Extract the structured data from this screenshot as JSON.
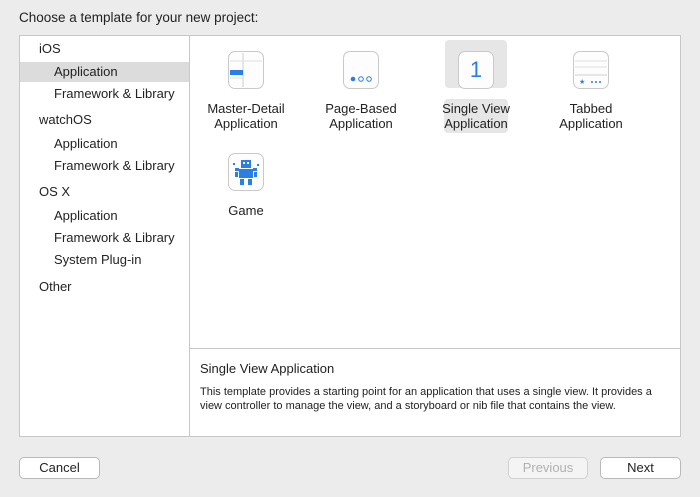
{
  "header": {
    "title": "Choose a template for your new project:"
  },
  "sidebar": {
    "groups": [
      {
        "label": "iOS",
        "items": [
          {
            "label": "Application",
            "selected": true
          },
          {
            "label": "Framework & Library"
          }
        ]
      },
      {
        "label": "watchOS",
        "items": [
          {
            "label": "Application"
          },
          {
            "label": "Framework & Library"
          }
        ]
      },
      {
        "label": "OS X",
        "items": [
          {
            "label": "Application"
          },
          {
            "label": "Framework & Library"
          },
          {
            "label": "System Plug-in"
          }
        ]
      },
      {
        "label": "Other",
        "items": []
      }
    ]
  },
  "templates": [
    {
      "line1": "Master-Detail",
      "line2": "Application",
      "icon": "master-detail-icon"
    },
    {
      "line1": "Page-Based",
      "line2": "Application",
      "icon": "page-based-icon"
    },
    {
      "line1": "Single View",
      "line2": "Application",
      "icon": "single-view-icon",
      "glyph": "1",
      "selected": true
    },
    {
      "line1": "Tabbed",
      "line2": "Application",
      "icon": "tabbed-icon",
      "glyph": "★ •••"
    },
    {
      "line1": "Game",
      "line2": "",
      "icon": "game-icon"
    }
  ],
  "description": {
    "title": "Single View Application",
    "text": "This template provides a starting point for an application that uses a single view. It provides a view controller to manage the view, and a storyboard or nib file that contains the view."
  },
  "buttons": {
    "cancel": "Cancel",
    "previous": "Previous",
    "next": "Next"
  },
  "colors": {
    "accent": "#2a7fe6",
    "selection": "#dcdcdc"
  }
}
